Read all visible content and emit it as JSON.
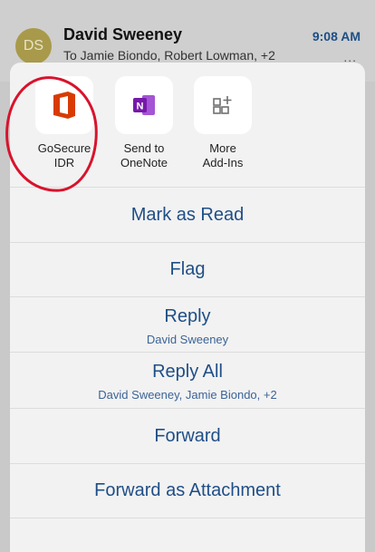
{
  "email": {
    "avatar_initials": "DS",
    "sender": "David Sweeney",
    "time": "9:08 AM",
    "recipients": "To Jamie Biondo, Robert Lowman, +2",
    "more": "..."
  },
  "addins": [
    {
      "label": "GoSecure\nIDR",
      "icon": "office-icon"
    },
    {
      "label": "Send to\nOneNote",
      "icon": "onenote-icon"
    },
    {
      "label": "More\nAdd-Ins",
      "icon": "add-ins-icon"
    }
  ],
  "actions": {
    "mark_as_read": "Mark as Read",
    "flag": "Flag",
    "reply": "Reply",
    "reply_sub": "David Sweeney",
    "reply_all": "Reply All",
    "reply_all_sub": "David Sweeney, Jamie Biondo, +2",
    "forward": "Forward",
    "forward_attachment": "Forward as Attachment"
  },
  "colors": {
    "action_text": "#1f4e86",
    "time": "#1c4f86",
    "office_red": "#d83b01",
    "onenote_purple": "#7719aa",
    "annotation_red": "#d8132c"
  }
}
